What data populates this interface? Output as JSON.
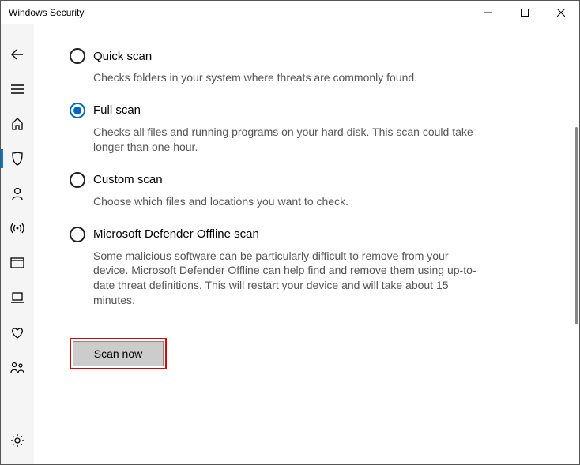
{
  "window": {
    "title": "Windows Security"
  },
  "scan_options": {
    "quick": {
      "label": "Quick scan",
      "desc": "Checks folders in your system where threats are commonly found."
    },
    "full": {
      "label": "Full scan",
      "desc": "Checks all files and running programs on your hard disk. This scan could take longer than one hour."
    },
    "custom": {
      "label": "Custom scan",
      "desc": "Choose which files and locations you want to check."
    },
    "offline": {
      "label": "Microsoft Defender Offline scan",
      "desc": "Some malicious software can be particularly difficult to remove from your device. Microsoft Defender Offline can help find and remove them using up-to-date threat definitions. This will restart your device and will take about 15 minutes."
    }
  },
  "selected_option": "full",
  "buttons": {
    "scan_now": "Scan now"
  }
}
